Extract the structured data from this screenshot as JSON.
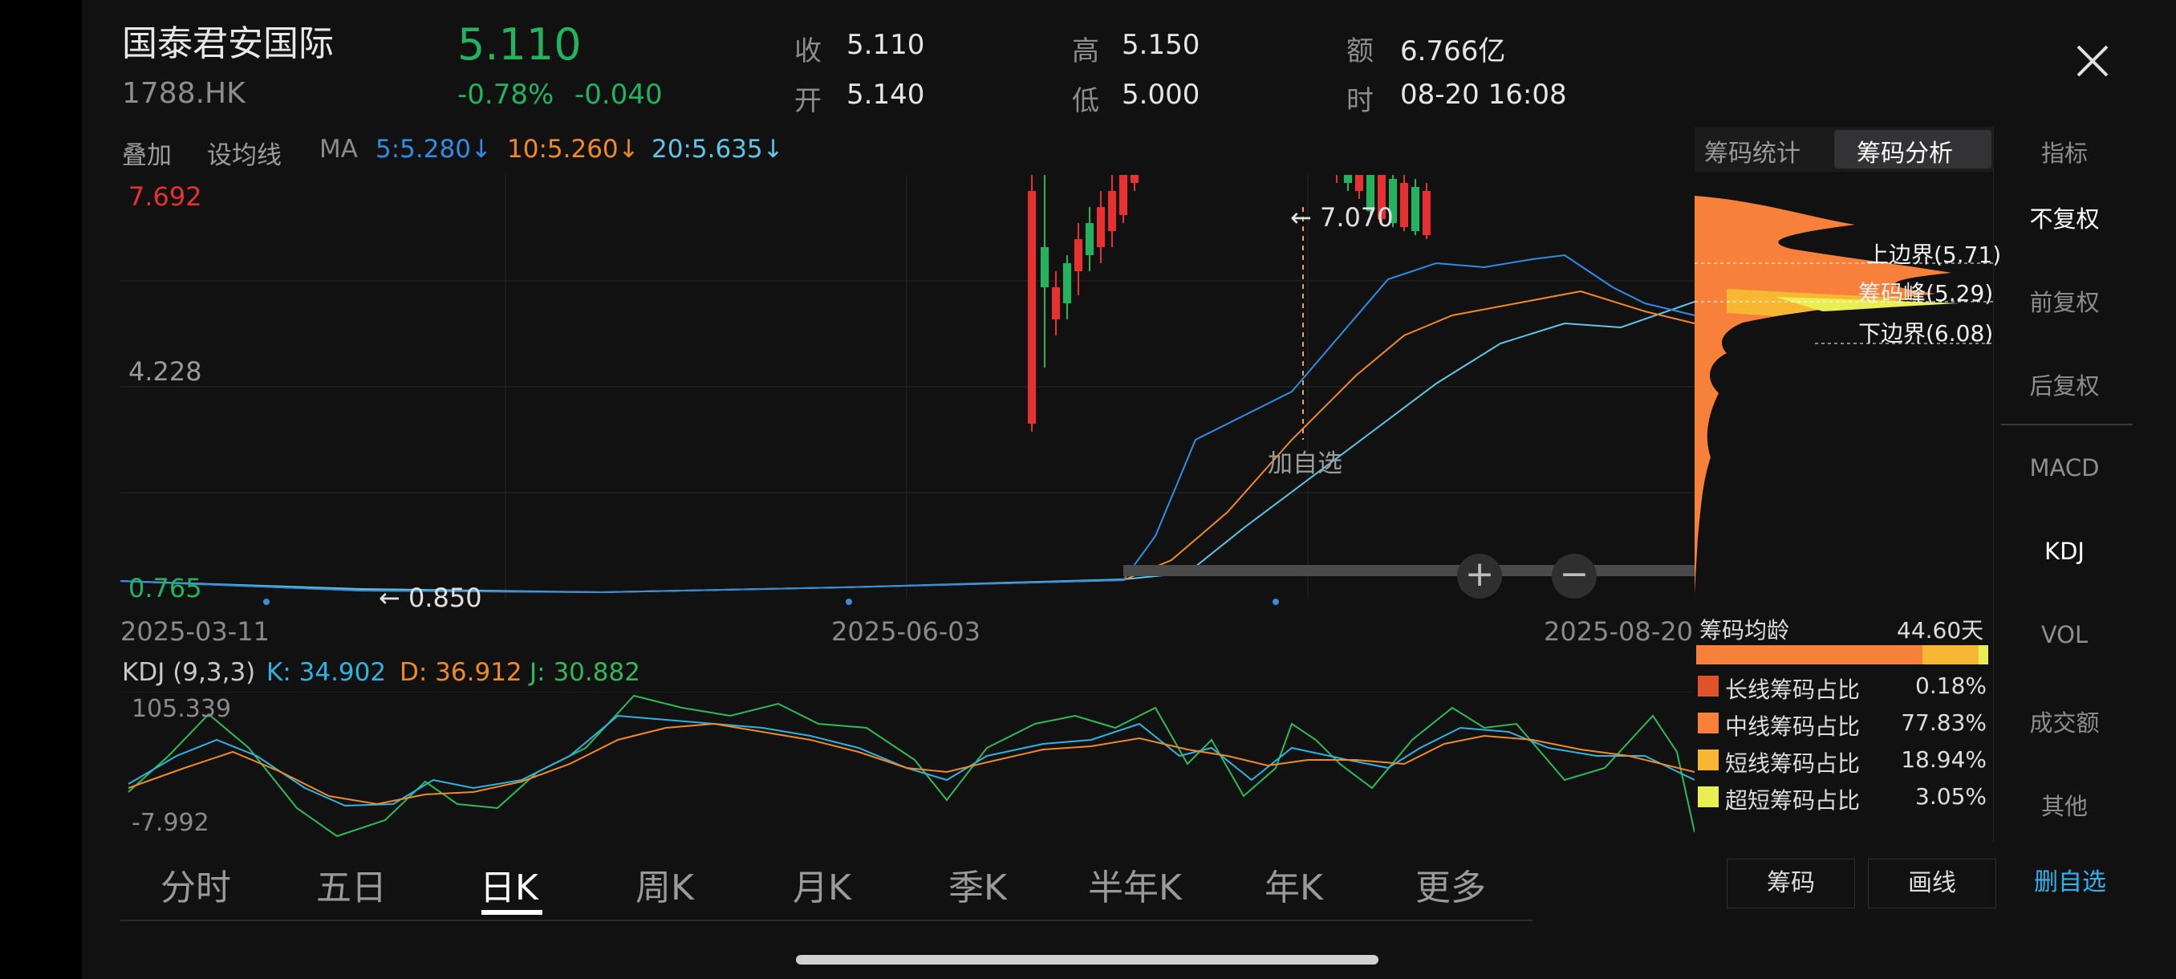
{
  "header": {
    "name": "国泰君安国际",
    "code": "1788.HK",
    "price": "5.110",
    "change_pct": "-0.78%",
    "change_abs": "-0.040",
    "close_label": "收",
    "close_value": "5.110",
    "open_label": "开",
    "open_value": "5.140",
    "high_label": "高",
    "high_value": "5.150",
    "low_label": "低",
    "low_value": "5.000",
    "amount_label": "额",
    "amount_value": "6.766亿",
    "time_label": "时",
    "time_value": "08-20 16:08"
  },
  "toolbar": {
    "overlay": "叠加",
    "set_ma": "设均线",
    "ma_label": "MA",
    "ma5": "5:5.280↓",
    "ma10": "10:5.260↓",
    "ma20": "20:5.635↓"
  },
  "chart_labels": {
    "y_top": "7.692",
    "y_mid": "4.228",
    "y_bottom": "0.765",
    "low_marker": "0.850",
    "high_marker": "7.070",
    "add_watch": "加自选",
    "dates": [
      "2025-03-11",
      "2025-06-03",
      "2025-08-20"
    ]
  },
  "kdj": {
    "title": "KDJ (9,3,3)",
    "k": "K: 34.902",
    "d": "D: 36.912",
    "j": "J: 30.882",
    "y_top": "105.339",
    "y_bottom": "-7.992"
  },
  "chip_panel": {
    "tabs": [
      "筹码统计",
      "筹码分析"
    ],
    "active_tab": 1,
    "upper": "上边界(5.71)",
    "peak": "筹码峰(5.29)",
    "lower": "下边界(6.08)",
    "avg_age_label": "筹码均龄",
    "avg_age_value": "44.60天",
    "rows": [
      {
        "label": "长线筹码占比",
        "value": "0.18%",
        "color": "#e0532a"
      },
      {
        "label": "中线筹码占比",
        "value": "77.83%",
        "color": "#f7803a"
      },
      {
        "label": "短线筹码占比",
        "value": "18.94%",
        "color": "#f7b733"
      },
      {
        "label": "超短筹码占比",
        "value": "3.05%",
        "color": "#e9ee55"
      }
    ]
  },
  "side_menu": {
    "indicator": "指标",
    "items": [
      "不复权",
      "前复权",
      "后复权",
      "MACD",
      "KDJ",
      "VOL",
      "成交额",
      "其他"
    ]
  },
  "period_tabs": [
    "分时",
    "五日",
    "日K",
    "周K",
    "月K",
    "季K",
    "半年K",
    "年K",
    "更多"
  ],
  "active_period": "日K",
  "bottom_buttons": {
    "chips": "筹码",
    "draw": "画线",
    "remove_watch": "删自选"
  },
  "colors": {
    "up": "#e93030",
    "down": "#22b35e",
    "k": "#2fb3e0",
    "d": "#f08a24",
    "j": "#2dbb55"
  }
}
